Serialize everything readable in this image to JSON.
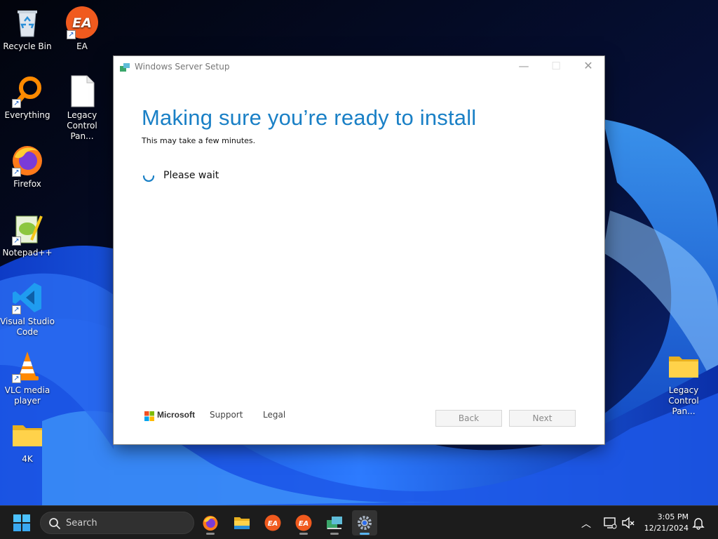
{
  "desktop": {
    "icons": [
      {
        "label": "Recycle Bin"
      },
      {
        "label": "EA"
      },
      {
        "label": "Everything"
      },
      {
        "label": "Legacy Control Pan..."
      },
      {
        "label": "Firefox"
      },
      {
        "label": "Notepad++"
      },
      {
        "label": "Visual Studio Code"
      },
      {
        "label": "VLC media player"
      },
      {
        "label": "4K"
      },
      {
        "label": "Legacy Control Pan..."
      }
    ]
  },
  "setup": {
    "window_title": "Windows Server Setup",
    "heading": "Making sure you’re ready to install",
    "subheading": "This may take a few minutes.",
    "status": "Please wait",
    "brand": "Microsoft",
    "support_label": "Support",
    "legal_label": "Legal",
    "back_label": "Back",
    "next_label": "Next"
  },
  "taskbar": {
    "search_placeholder": "Search",
    "time": "3:05 PM",
    "date": "12/21/2024",
    "pinned": [
      "firefox-icon",
      "file-explorer-icon",
      "ea-icon",
      "ea-icon",
      "setup-icon",
      "settings-icon"
    ]
  },
  "colors": {
    "heading": "#1a80c6",
    "taskbar": "#1c1c1c",
    "accent": "#5ab4f0"
  }
}
